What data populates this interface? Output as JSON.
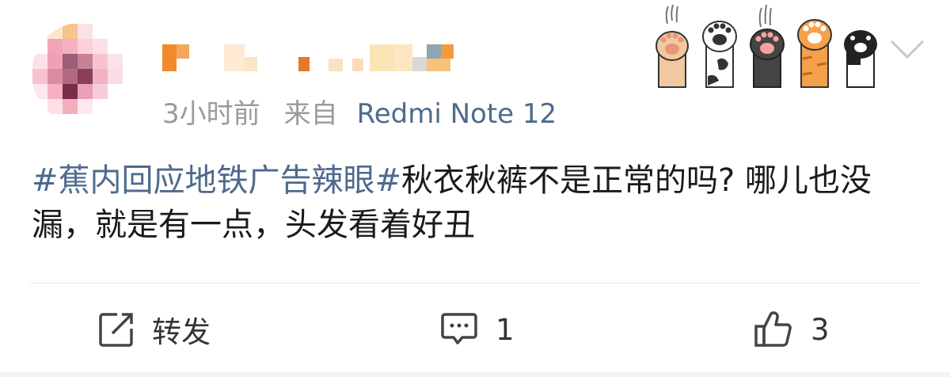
{
  "post": {
    "time": "3小时前",
    "source_prefix": "来自",
    "device": "Redmi Note 12",
    "hashtag": "#蕉内回应地铁广告辣眼#",
    "text": "秋衣秋裤不是正常的吗? 哪儿也没漏，就是有一点，头发看着好丑"
  },
  "actions": {
    "repost_label": "转发",
    "comment_count": "1",
    "like_count": "3"
  },
  "icons": [
    "avatar-pixelated",
    "cat-paws-icon",
    "chevron-down-icon",
    "repost-icon",
    "comment-icon",
    "like-icon"
  ],
  "colors": {
    "link": "#4e6a8e",
    "meta": "#9a9a9a",
    "text": "#1a1a1a"
  }
}
